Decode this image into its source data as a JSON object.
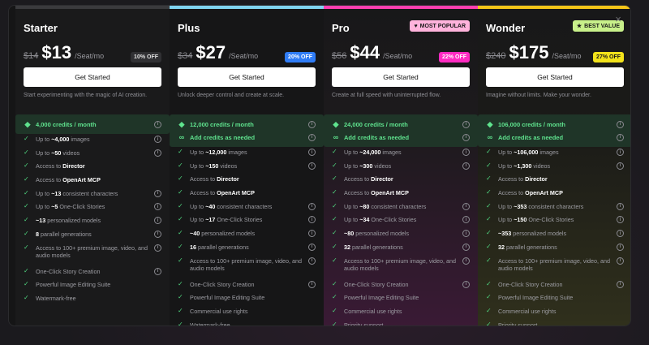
{
  "colors": {
    "starter_bar": "#3a3a3d",
    "plus_bar": "#7fd4f0",
    "pro_bar": "#ff3fb1",
    "wonder_bar": "#f5c518",
    "plus_off": "#2f7cf6",
    "pro_off": "#ff2bc2",
    "wonder_off": "#f2e21a",
    "starter_off": "#303033",
    "credits_text": "#5fe38e",
    "check": "#4fd47e"
  },
  "window": {
    "close_icon": "×"
  },
  "plans": [
    {
      "name": "Starter",
      "old_price": "$14",
      "price": "$13",
      "per": "/Seat/mo",
      "off": "10% OFF",
      "button": "Get Started",
      "desc": "Start experimenting with the magic of AI creation.",
      "credits": "4,000 credits / month",
      "features": [
        {
          "pre": "Up to ",
          "bold": "~4,000",
          "post": " images",
          "info": true
        },
        {
          "pre": "Up to ",
          "bold": "~50",
          "post": " videos",
          "info": true
        },
        {
          "pre": "Access to ",
          "bold": "Director",
          "post": "",
          "info": false
        },
        {
          "pre": "Access to ",
          "bold": "OpenArt MCP",
          "post": "",
          "info": false
        },
        {
          "pre": "Up to ",
          "bold": "~13",
          "post": " consistent characters",
          "info": true
        },
        {
          "pre": "Up to ",
          "bold": "~5",
          "post": " One-Click Stories",
          "info": true
        },
        {
          "pre": "",
          "bold": "~13",
          "post": " personalized models",
          "info": true
        },
        {
          "pre": "",
          "bold": "8",
          "post": " parallel generations",
          "info": true
        },
        {
          "pre": "Access to 100+ premium image, video, and audio models",
          "bold": "",
          "post": "",
          "info": true
        },
        {
          "pre": "One-Click Story Creation",
          "bold": "",
          "post": "",
          "info": true
        },
        {
          "pre": "Powerful Image Editing Suite",
          "bold": "",
          "post": "",
          "info": false
        },
        {
          "pre": "Watermark-free",
          "bold": "",
          "post": "",
          "info": false
        }
      ]
    },
    {
      "name": "Plus",
      "old_price": "$34",
      "price": "$27",
      "per": "/Seat/mo",
      "off": "20% OFF",
      "button": "Get Started",
      "desc": "Unlock deeper control and create at scale.",
      "credits": "12,000 credits / month",
      "add_credits": "Add credits as needed",
      "features": [
        {
          "pre": "Up to ",
          "bold": "~12,000",
          "post": " images",
          "info": true
        },
        {
          "pre": "Up to ",
          "bold": "~150",
          "post": " videos",
          "info": true
        },
        {
          "pre": "Access to ",
          "bold": "Director",
          "post": "",
          "info": false
        },
        {
          "pre": "Access to ",
          "bold": "OpenArt MCP",
          "post": "",
          "info": false
        },
        {
          "pre": "Up to ",
          "bold": "~40",
          "post": " consistent characters",
          "info": true
        },
        {
          "pre": "Up to ",
          "bold": "~17",
          "post": " One-Click Stories",
          "info": true
        },
        {
          "pre": "",
          "bold": "~40",
          "post": " personalized models",
          "info": true
        },
        {
          "pre": "",
          "bold": "16",
          "post": " parallel generations",
          "info": true
        },
        {
          "pre": "Access to 100+ premium image, video, and audio models",
          "bold": "",
          "post": "",
          "info": true
        },
        {
          "pre": "One-Click Story Creation",
          "bold": "",
          "post": "",
          "info": true
        },
        {
          "pre": "Powerful Image Editing Suite",
          "bold": "",
          "post": "",
          "info": false
        },
        {
          "pre": "Commercial use rights",
          "bold": "",
          "post": "",
          "info": false
        },
        {
          "pre": "Watermark-free",
          "bold": "",
          "post": "",
          "info": false
        }
      ]
    },
    {
      "name": "Pro",
      "old_price": "$56",
      "price": "$44",
      "per": "/Seat/mo",
      "off": "22% OFF",
      "tag": "MOST POPULAR",
      "tag_icon": "♥",
      "button": "Get Started",
      "desc": "Create at full speed with uninterrupted flow.",
      "credits": "24,000 credits / month",
      "add_credits": "Add credits as needed",
      "features": [
        {
          "pre": "Up to ",
          "bold": "~24,000",
          "post": " images",
          "info": true
        },
        {
          "pre": "Up to ",
          "bold": "~300",
          "post": " videos",
          "info": true
        },
        {
          "pre": "Access to ",
          "bold": "Director",
          "post": "",
          "info": false
        },
        {
          "pre": "Access to ",
          "bold": "OpenArt MCP",
          "post": "",
          "info": false
        },
        {
          "pre": "Up to ",
          "bold": "~80",
          "post": " consistent characters",
          "info": true
        },
        {
          "pre": "Up to ",
          "bold": "~34",
          "post": " One-Click Stories",
          "info": true
        },
        {
          "pre": "",
          "bold": "~80",
          "post": " personalized models",
          "info": true
        },
        {
          "pre": "",
          "bold": "32",
          "post": " parallel generations",
          "info": true
        },
        {
          "pre": "Access to 100+ premium image, video, and audio models",
          "bold": "",
          "post": "",
          "info": true
        },
        {
          "pre": "One-Click Story Creation",
          "bold": "",
          "post": "",
          "info": true
        },
        {
          "pre": "Powerful Image Editing Suite",
          "bold": "",
          "post": "",
          "info": false
        },
        {
          "pre": "Commercial use rights",
          "bold": "",
          "post": "",
          "info": false
        },
        {
          "pre": "Priority support",
          "bold": "",
          "post": "",
          "info": false
        }
      ]
    },
    {
      "name": "Wonder",
      "old_price": "$240",
      "price": "$175",
      "per": "/Seat/mo",
      "off": "27% OFF",
      "tag": "BEST VALUE",
      "tag_icon": "★",
      "button": "Get Started",
      "desc": "Imagine without limits. Make your wonder.",
      "credits": "106,000 credits / month",
      "add_credits": "Add credits as needed",
      "features": [
        {
          "pre": "Up to ",
          "bold": "~106,000",
          "post": " images",
          "info": true
        },
        {
          "pre": "Up to ",
          "bold": "~1,300",
          "post": " videos",
          "info": true
        },
        {
          "pre": "Access to ",
          "bold": "Director",
          "post": "",
          "info": false
        },
        {
          "pre": "Access to ",
          "bold": "OpenArt MCP",
          "post": "",
          "info": false
        },
        {
          "pre": "Up to ",
          "bold": "~353",
          "post": " consistent characters",
          "info": true
        },
        {
          "pre": "Up to ",
          "bold": "~150",
          "post": " One-Click Stories",
          "info": true
        },
        {
          "pre": "",
          "bold": "~353",
          "post": " personalized models",
          "info": true
        },
        {
          "pre": "",
          "bold": "32",
          "post": " parallel generations",
          "info": true
        },
        {
          "pre": "Access to 100+ premium image, video, and audio models",
          "bold": "",
          "post": "",
          "info": true
        },
        {
          "pre": "One-Click Story Creation",
          "bold": "",
          "post": "",
          "info": true
        },
        {
          "pre": "Powerful Image Editing Suite",
          "bold": "",
          "post": "",
          "info": false
        },
        {
          "pre": "Commercial use rights",
          "bold": "",
          "post": "",
          "info": false
        },
        {
          "pre": "Priority support",
          "bold": "",
          "post": "",
          "info": false
        }
      ]
    }
  ]
}
